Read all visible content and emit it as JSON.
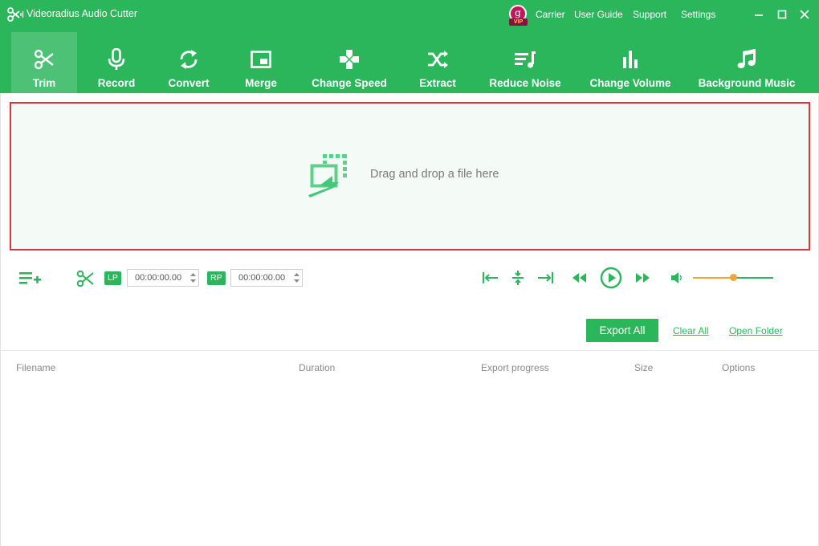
{
  "app": {
    "title": "Videoradius Audio Cutter"
  },
  "vip": {
    "initial": "g",
    "tag": "VIP"
  },
  "top_links": {
    "carrier": "Carrier",
    "user_guide": "User Guide",
    "support": "Support",
    "settings": "Settings"
  },
  "toolbar": {
    "active": "Trim",
    "items": [
      {
        "label": "Trim",
        "icon": "scissors-icon"
      },
      {
        "label": "Record",
        "icon": "microphone-icon"
      },
      {
        "label": "Convert",
        "icon": "convert-arrows-icon"
      },
      {
        "label": "Merge",
        "icon": "merge-window-icon"
      },
      {
        "label": "Change Speed",
        "icon": "gamepad-icon"
      },
      {
        "label": "Extract",
        "icon": "shuffle-icon"
      },
      {
        "label": "Reduce Noise",
        "icon": "noise-list-icon"
      },
      {
        "label": "Change Volume",
        "icon": "bars-icon"
      },
      {
        "label": "Background Music",
        "icon": "music-note-icon"
      }
    ]
  },
  "dropzone": {
    "text": "Drag and drop a file here",
    "icon": "drop-file-icon"
  },
  "controls": {
    "lp_label": "LP",
    "lp_value": "00:00:00.00",
    "rp_label": "RP",
    "rp_value": "00:00:00.00",
    "volume_level": 0.5
  },
  "export": {
    "export_all": "Export All",
    "clear_all": "Clear All",
    "open_folder": "Open Folder"
  },
  "table": {
    "columns": [
      "Filename",
      "Duration",
      "Export progress",
      "Size",
      "Options"
    ],
    "rows": []
  },
  "colors": {
    "brand_green": "#2cb65c",
    "drop_border": "#e3333b",
    "slider_accent": "#f2a33c",
    "vip": "#c2185b"
  }
}
